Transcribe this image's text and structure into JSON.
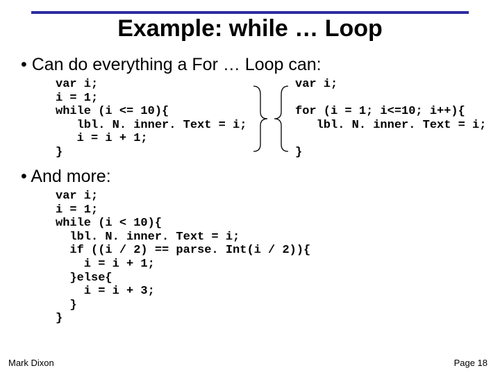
{
  "title": "Example: while … Loop",
  "bullets": {
    "b1": "Can do everything a For … Loop can:",
    "b2": "And more:"
  },
  "code": {
    "while1": "var i;\ni = 1;\nwhile (i <= 10){\n   lbl. N. inner. Text = i;\n   i = i + 1;\n}",
    "for1": "var i;\n\nfor (i = 1; i<=10; i++){\n   lbl. N. inner. Text = i;\n\n}",
    "while2": "var i;\ni = 1;\nwhile (i < 10){\n  lbl. N. inner. Text = i;\n  if ((i / 2) == parse. Int(i / 2)){\n    i = i + 1;\n  }else{\n    i = i + 3;\n  }\n}"
  },
  "footer": {
    "author": "Mark Dixon",
    "page": "Page 18"
  }
}
